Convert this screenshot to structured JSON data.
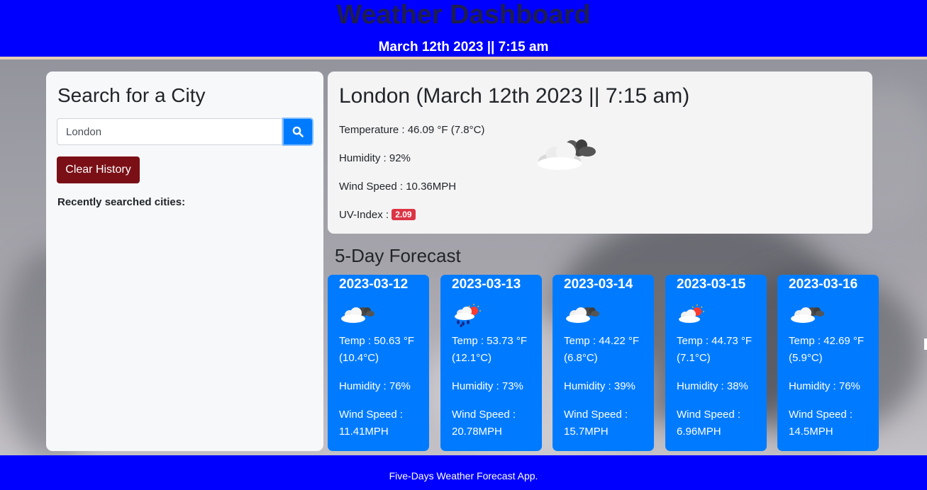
{
  "header": {
    "title": "Weather Dashboard",
    "datetime": "March 12th 2023 || 7:15 am"
  },
  "search": {
    "heading": "Search for a City",
    "input_value": "London",
    "search_icon": "search-icon",
    "clear_label": "Clear History",
    "recent_label": "Recently searched cities:"
  },
  "current": {
    "heading": "London (March 12th 2023 || 7:15 am)",
    "temperature": "Temperature : 46.09 °F (7.8°C)",
    "humidity": "Humidity : 92%",
    "wind": "Wind Speed : 10.36MPH",
    "uv_label": "UV-Index : ",
    "uv_value": "2.09",
    "uv_color": "#dc3545",
    "icon": "cloudy-icon"
  },
  "forecast": {
    "title": "5-Day Forecast",
    "days": [
      {
        "date": "2023-03-12",
        "icon": "cloudy-icon",
        "temp": "Temp : 50.63 °F (10.4°C)",
        "humidity": "Humidity : 76%",
        "wind": "Wind Speed : 11.41MPH"
      },
      {
        "date": "2023-03-13",
        "icon": "rain-sun-icon",
        "temp": "Temp : 53.73 °F (12.1°C)",
        "humidity": "Humidity : 73%",
        "wind": "Wind Speed : 20.78MPH"
      },
      {
        "date": "2023-03-14",
        "icon": "cloudy-icon",
        "temp": "Temp : 44.22 °F (6.8°C)",
        "humidity": "Humidity : 39%",
        "wind": "Wind Speed : 15.7MPH"
      },
      {
        "date": "2023-03-15",
        "icon": "partly-cloudy-icon",
        "temp": "Temp : 44.73 °F (7.1°C)",
        "humidity": "Humidity : 38%",
        "wind": "Wind Speed : 6.96MPH"
      },
      {
        "date": "2023-03-16",
        "icon": "cloudy-icon",
        "temp": "Temp : 42.69 °F (5.9°C)",
        "humidity": "Humidity : 76%",
        "wind": "Wind Speed : 14.5MPH"
      }
    ]
  },
  "footer": {
    "text": "Five-Days Weather Forecast App."
  },
  "colors": {
    "header_bg": "#0000ff",
    "card_bg": "#007bff",
    "clear_btn": "#7a1016"
  }
}
